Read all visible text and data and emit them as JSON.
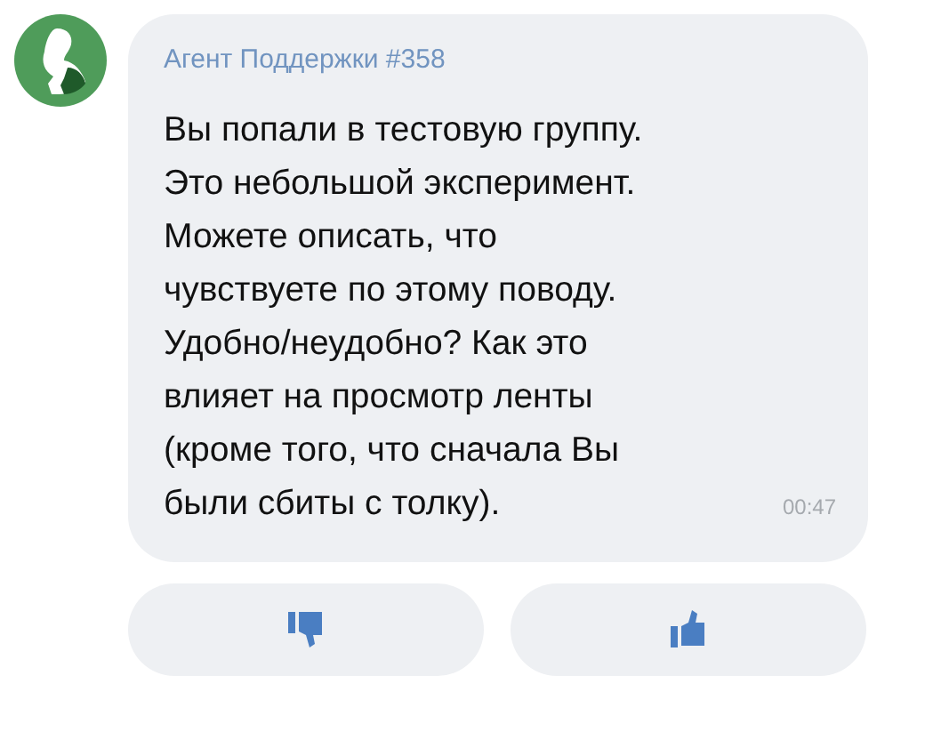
{
  "message": {
    "sender": "Агент Поддержки #358",
    "text": "Вы попали в тестовую группу.\nЭто небольшой эксперимент.\nМожете описать, что\nчувствуете по этому поводу.\nУдобно/неудобно? Как это\nвлияет на просмотр ленты\n(кроме того, что сначала Вы\nбыли сбиты с толку).",
    "time": "00:47"
  },
  "reactions": [
    {
      "kind": "dislike"
    },
    {
      "kind": "like"
    }
  ]
}
